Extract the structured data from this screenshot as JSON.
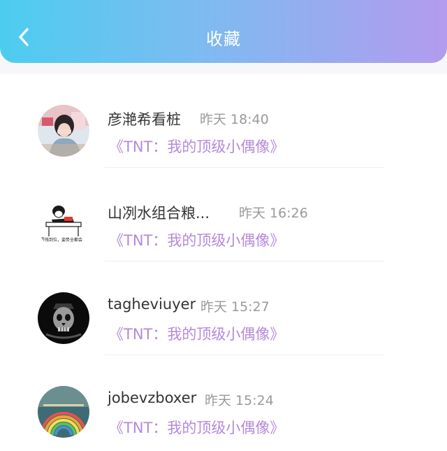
{
  "header": {
    "title": "收藏",
    "back_icon": "chevron-left-icon",
    "gradient_start": "#4ccdf0",
    "gradient_end": "#b39bee"
  },
  "favorites": [
    {
      "username": "彦滟希看桩",
      "time": "昨天 18:40",
      "video_title": "《TNT：我的顶级小偶像》",
      "avatar": "girl-photo-avatar"
    },
    {
      "username": "山冽水组合粮...",
      "time": "昨天 16:26",
      "video_title": "《TNT：我的顶级小偶像》",
      "avatar": "cartoon-desk-avatar",
      "avatar_caption": "要钱到位，姿势全都会"
    },
    {
      "username": "tagheviuyer",
      "time": "昨天 15:27",
      "video_title": "《TNT：我的顶级小偶像》",
      "avatar": "dark-skull-avatar"
    },
    {
      "username": "jobevzboxer",
      "time": "昨天 15:24",
      "video_title": "《TNT：我的顶级小偶像》",
      "avatar": "rainbow-scenery-avatar"
    }
  ],
  "colors": {
    "link": "#b48ad8",
    "username": "#333333",
    "time": "#9a9a9a"
  }
}
